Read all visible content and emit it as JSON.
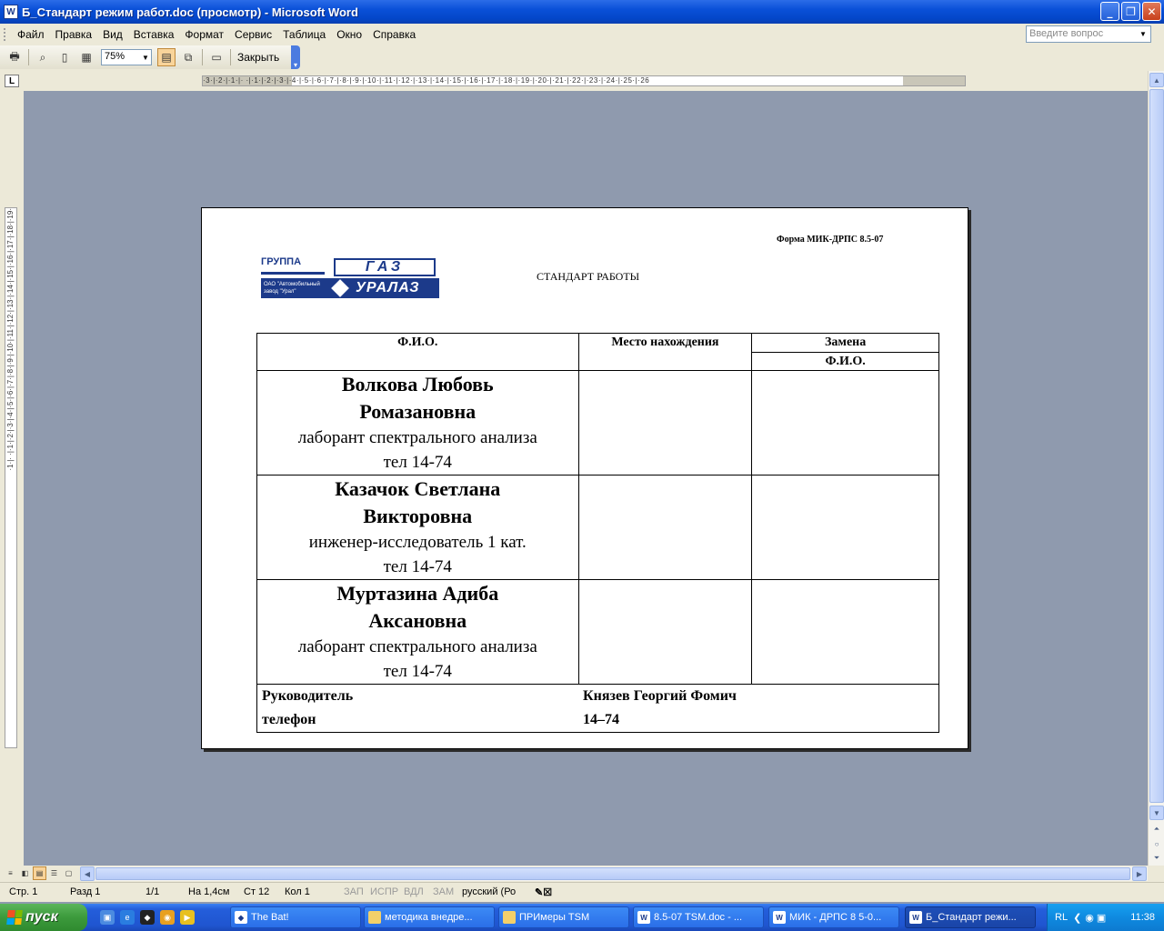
{
  "window": {
    "title": "Б_Стандарт режим работ.doc (просмотр) - Microsoft Word",
    "app_icon": "word-icon"
  },
  "menu": {
    "items": [
      "Файл",
      "Правка",
      "Вид",
      "Вставка",
      "Формат",
      "Сервис",
      "Таблица",
      "Окно",
      "Справка"
    ],
    "ask_placeholder": "Введите вопрос"
  },
  "toolbar": {
    "zoom": "75%",
    "close_label": "Закрыть"
  },
  "ruler": {
    "h_numbers": "·3·|·2·|·1·|·   ·|·1·|·2·|·3·|·4·|·5·|·6·|·7·|·8·|·9·|·10·|·11·|·12·|·13·|·14·|·15·|·16·|·17·|·18·|·19·|·20·|·21·|·22·|·23·|·24·|·25·|·26",
    "v_numbers": "·1·|·   ·|·1·|·2·|·3·|·4·|·5·|·6·|·7·|·8·|·9·|·10·|·11·|·12·|·13·|·14·|·15·|·16·|·17·|·18·|·19·"
  },
  "document": {
    "form_code": "Форма МИК-ДРПС 8.5-07",
    "title": "СТАНДАРТ РАБОТЫ",
    "logo": {
      "group": "ГРУППА",
      "gaz": "ГАЗ",
      "plant": "ОАО \"Автомобильный завод \"Урал\"",
      "ural": "УРАЛАЗ"
    },
    "table": {
      "headers": {
        "fio": "Ф.И.О.",
        "location": "Место нахождения",
        "replacement": "Замена",
        "replacement_fio": "Ф.И.О."
      },
      "rows": [
        {
          "name_line1": "Волкова  Любовь",
          "name_line2": "Ромазановна",
          "position": "лаборант спектрального анализа",
          "phone": "тел 14-74"
        },
        {
          "name_line1": "Казачок Светлана",
          "name_line2": "Викторовна",
          "position": "инженер-исследователь 1 кат.",
          "phone": "тел 14-74"
        },
        {
          "name_line1": "Муртазина Адиба",
          "name_line2": "Аксановна",
          "position": "лаборант спектрального анализа",
          "phone": "тел 14-74"
        }
      ],
      "footer": {
        "manager_label": "Руководитель",
        "manager_name": "Князев Георгий Фомич",
        "phone_label": "телефон",
        "phone_value": "14–74"
      }
    }
  },
  "status": {
    "page": "Стр. 1",
    "section": "Разд 1",
    "pages": "1/1",
    "position": "На 1,4см",
    "line": "Ст 12",
    "column": "Кол 1",
    "rec": "ЗАП",
    "trk": "ИСПР",
    "ext": "ВДЛ",
    "ovr": "ЗАМ",
    "language": "русский (Ро"
  },
  "taskbar": {
    "start": "пуск",
    "tasks": [
      "The Bat!",
      "методика внедре...",
      "ПРИмеры TSM",
      "8.5-07 TSM.doc - ...",
      "МИК - ДРПС 8 5-0...",
      "Б_Стандарт режи..."
    ],
    "lang": "RL",
    "clock": "11:38"
  }
}
